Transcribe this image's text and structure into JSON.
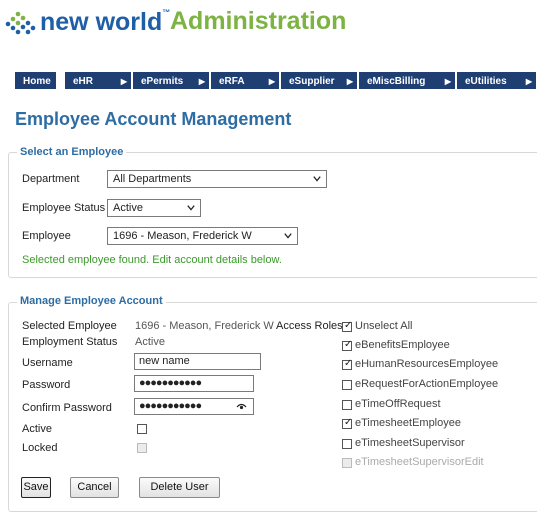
{
  "header": {
    "brand": "new world",
    "brand_tm": "™",
    "section": "Administration"
  },
  "nav": {
    "items": [
      {
        "label": "Home"
      },
      {
        "label": "eHR"
      },
      {
        "label": "ePermits"
      },
      {
        "label": "eRFA"
      },
      {
        "label": "eSupplier"
      },
      {
        "label": "eMiscBilling"
      },
      {
        "label": "eUtilities"
      }
    ],
    "arrow": "▶"
  },
  "page_title": "Employee Account Management",
  "select_employee": {
    "legend": "Select an Employee",
    "department_label": "Department",
    "department_value": "All Departments",
    "status_label": "Employee Status",
    "status_value": "Active",
    "employee_label": "Employee",
    "employee_value": "1696 - Meason, Frederick W",
    "message": "Selected employee found. Edit account details below."
  },
  "manage_account": {
    "legend": "Manage Employee Account",
    "selected_employee_label": "Selected Employee",
    "selected_employee_value": "1696 - Meason, Frederick W",
    "employment_status_label": "Employment Status",
    "employment_status_value": "Active",
    "username_label": "Username",
    "username_value": "new name",
    "password_label": "Password",
    "password_value": "●●●●●●●●●●●",
    "confirm_label": "Confirm Password",
    "confirm_value": "●●●●●●●●●●●",
    "active_label": "Active",
    "active_checked": false,
    "locked_label": "Locked",
    "locked_checked": false,
    "access_roles_label": "Access Roles",
    "roles": [
      {
        "label": "Unselect All",
        "checked": true,
        "disabled": false
      },
      {
        "label": "eBenefitsEmployee",
        "checked": true,
        "disabled": false
      },
      {
        "label": "eHumanResourcesEmployee",
        "checked": true,
        "disabled": false
      },
      {
        "label": "eRequestForActionEmployee",
        "checked": false,
        "disabled": false
      },
      {
        "label": "eTimeOffRequest",
        "checked": false,
        "disabled": false
      },
      {
        "label": "eTimesheetEmployee",
        "checked": true,
        "disabled": false
      },
      {
        "label": "eTimesheetSupervisor",
        "checked": false,
        "disabled": false
      },
      {
        "label": "eTimesheetSupervisorEdit",
        "checked": false,
        "disabled": true
      }
    ]
  },
  "buttons": {
    "save": "Save",
    "cancel": "Cancel",
    "delete_user": "Delete User"
  },
  "colors": {
    "brand_blue": "#1f5fa6",
    "brand_green": "#7cb342",
    "nav_bg": "#1f3f73",
    "title_blue": "#2e6da4",
    "success_green": "#3a9a2a"
  }
}
